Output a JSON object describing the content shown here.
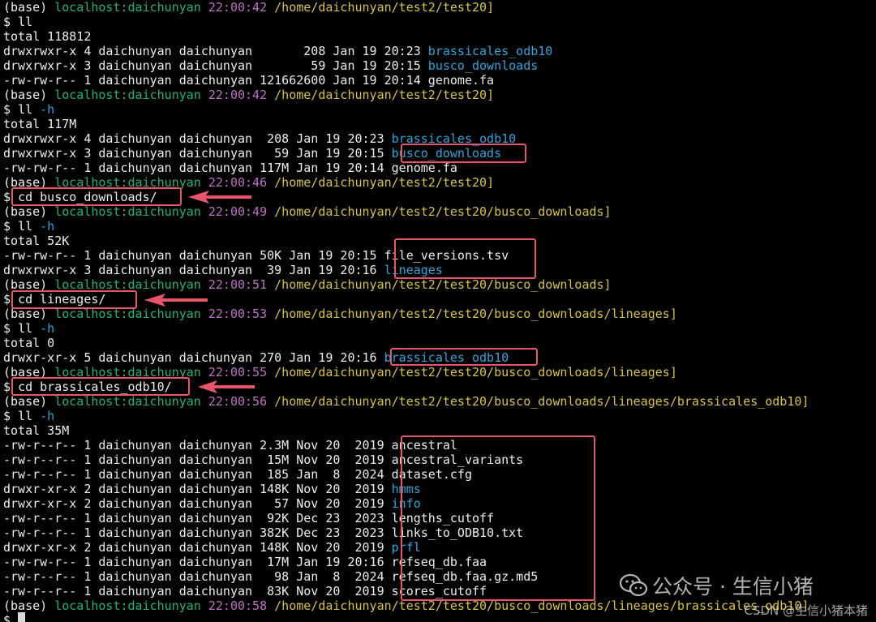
{
  "terminal": {
    "lines": [
      {
        "kind": "prompt",
        "env": "(base)",
        "host": "localhost:daichunyan",
        "time": "22:00:42",
        "path": "/home/daichunyan/test2/test20]"
      },
      {
        "kind": "cmd",
        "cmd": "ll",
        "opt": ""
      },
      {
        "kind": "text",
        "text": "total 118812"
      },
      {
        "kind": "entry",
        "prefix": "drwxrwxr-x 4 daichunyan daichunyan       208 Jan 19 20:23 ",
        "name": "brassicales_odb10",
        "type": "dir"
      },
      {
        "kind": "entry",
        "prefix": "drwxrwxr-x 3 daichunyan daichunyan        59 Jan 19 20:15 ",
        "name": "busco_downloads",
        "type": "dir"
      },
      {
        "kind": "entry",
        "prefix": "-rw-rw-r-- 1 daichunyan daichunyan 121662600 Jan 19 20:14 ",
        "name": "genome.fa",
        "type": "file"
      },
      {
        "kind": "prompt",
        "env": "(base)",
        "host": "localhost:daichunyan",
        "time": "22:00:42",
        "path": "/home/daichunyan/test2/test20]"
      },
      {
        "kind": "cmd",
        "cmd": "ll",
        "opt": "-h"
      },
      {
        "kind": "text",
        "text": "total 117M"
      },
      {
        "kind": "entry",
        "prefix": "drwxrwxr-x 4 daichunyan daichunyan  208 Jan 19 20:23 ",
        "name": "brassicales_odb10",
        "type": "dir"
      },
      {
        "kind": "entry",
        "prefix": "drwxrwxr-x 3 daichunyan daichunyan   59 Jan 19 20:15 ",
        "name": "busco_downloads",
        "type": "dir"
      },
      {
        "kind": "entry",
        "prefix": "-rw-rw-r-- 1 daichunyan daichunyan 117M Jan 19 20:14 ",
        "name": "genome.fa",
        "type": "file"
      },
      {
        "kind": "prompt",
        "env": "(base)",
        "host": "localhost:daichunyan",
        "time": "22:00:46",
        "path": "/home/daichunyan/test2/test20]"
      },
      {
        "kind": "cmd",
        "cmd": "cd busco_downloads/",
        "opt": ""
      },
      {
        "kind": "prompt",
        "env": "(base)",
        "host": "localhost:daichunyan",
        "time": "22:00:49",
        "path": "/home/daichunyan/test2/test20/busco_downloads]"
      },
      {
        "kind": "cmd",
        "cmd": "ll",
        "opt": "-h"
      },
      {
        "kind": "text",
        "text": "total 52K"
      },
      {
        "kind": "entry",
        "prefix": "-rw-rw-r-- 1 daichunyan daichunyan 50K Jan 19 20:15 ",
        "name": "file_versions.tsv",
        "type": "file"
      },
      {
        "kind": "entry",
        "prefix": "drwxrwxr-x 3 daichunyan daichunyan  39 Jan 19 20:16 ",
        "name": "lineages",
        "type": "dir"
      },
      {
        "kind": "prompt",
        "env": "(base)",
        "host": "localhost:daichunyan",
        "time": "22:00:51",
        "path": "/home/daichunyan/test2/test20/busco_downloads]"
      },
      {
        "kind": "cmd",
        "cmd": "cd lineages/",
        "opt": ""
      },
      {
        "kind": "prompt",
        "env": "(base)",
        "host": "localhost:daichunyan",
        "time": "22:00:53",
        "path": "/home/daichunyan/test2/test20/busco_downloads/lineages]"
      },
      {
        "kind": "cmd",
        "cmd": "ll",
        "opt": "-h"
      },
      {
        "kind": "text",
        "text": "total 0"
      },
      {
        "kind": "entry",
        "prefix": "drwxr-xr-x 5 daichunyan daichunyan 270 Jan 19 20:16 ",
        "name": "brassicales_odb10",
        "type": "dir"
      },
      {
        "kind": "prompt",
        "env": "(base)",
        "host": "localhost:daichunyan",
        "time": "22:00:55",
        "path": "/home/daichunyan/test2/test20/busco_downloads/lineages]"
      },
      {
        "kind": "cmd",
        "cmd": "cd brassicales_odb10/",
        "opt": ""
      },
      {
        "kind": "prompt",
        "env": "(base)",
        "host": "localhost:daichunyan",
        "time": "22:00:56",
        "path": "/home/daichunyan/test2/test20/busco_downloads/lineages/brassicales_odb10]"
      },
      {
        "kind": "cmd",
        "cmd": "ll",
        "opt": "-h"
      },
      {
        "kind": "text",
        "text": "total 35M"
      },
      {
        "kind": "entry",
        "prefix": "-rw-r--r-- 1 daichunyan daichunyan 2.3M Nov 20  2019 ",
        "name": "ancestral",
        "type": "file"
      },
      {
        "kind": "entry",
        "prefix": "-rw-r--r-- 1 daichunyan daichunyan  15M Nov 20  2019 ",
        "name": "ancestral_variants",
        "type": "file"
      },
      {
        "kind": "entry",
        "prefix": "-rw-r--r-- 1 daichunyan daichunyan  185 Jan  8  2024 ",
        "name": "dataset.cfg",
        "type": "file"
      },
      {
        "kind": "entry",
        "prefix": "drwxr-xr-x 2 daichunyan daichunyan 148K Nov 20  2019 ",
        "name": "hmms",
        "type": "dir"
      },
      {
        "kind": "entry",
        "prefix": "drwxr-xr-x 2 daichunyan daichunyan   57 Nov 20  2019 ",
        "name": "info",
        "type": "dir"
      },
      {
        "kind": "entry",
        "prefix": "-rw-r--r-- 1 daichunyan daichunyan  92K Dec 23  2023 ",
        "name": "lengths_cutoff",
        "type": "file"
      },
      {
        "kind": "entry",
        "prefix": "-rw-r--r-- 1 daichunyan daichunyan 382K Dec 23  2023 ",
        "name": "links_to_ODB10.txt",
        "type": "file"
      },
      {
        "kind": "entry",
        "prefix": "drwxr-xr-x 2 daichunyan daichunyan 148K Nov 20  2019 ",
        "name": "prfl",
        "type": "dir"
      },
      {
        "kind": "entry",
        "prefix": "-rw-rw-r-- 1 daichunyan daichunyan  17M Jan 19 20:16 ",
        "name": "refseq_db.faa",
        "type": "file"
      },
      {
        "kind": "entry",
        "prefix": "-rw-r--r-- 1 daichunyan daichunyan   98 Jan  8  2024 ",
        "name": "refseq_db.faa.gz.md5",
        "type": "file"
      },
      {
        "kind": "entry",
        "prefix": "-rw-r--r-- 1 daichunyan daichunyan  83K Nov 20  2019 ",
        "name": "scores_cutoff",
        "type": "file"
      },
      {
        "kind": "prompt",
        "env": "(base)",
        "host": "localhost:daichunyan",
        "time": "22:00:58",
        "path": "/home/daichunyan/test2/test20/busco_downloads/lineages/brassicales_odb10]"
      },
      {
        "kind": "cmd",
        "cmd": "",
        "opt": ""
      }
    ]
  },
  "watermark": {
    "brand": "公众号 · 生信小猪",
    "credit": "CSDN @生信小猪本猪"
  },
  "colors": {
    "background": "#000000",
    "host": "#1fb37a",
    "time": "#c06ec6",
    "path": "#d6c43b",
    "directory": "#2aa6dc",
    "highlight": "#e8546a"
  }
}
